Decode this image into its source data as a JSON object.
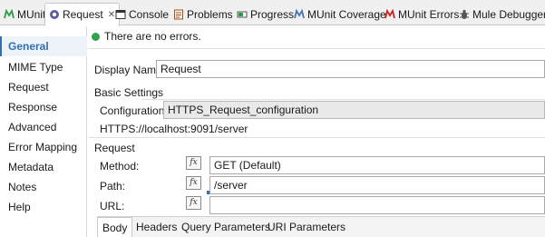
{
  "tabs": [
    {
      "label": "MUnit",
      "icon": "munit-icon",
      "color": "#2e9a47"
    },
    {
      "label": "Request",
      "icon": "request-icon",
      "color": "#5a5aa8",
      "active": true
    },
    {
      "label": "Console",
      "icon": "console-icon",
      "color": "#333333"
    },
    {
      "label": "Problems",
      "icon": "problems-icon",
      "color": "#a0522d"
    },
    {
      "label": "Progress",
      "icon": "progress-icon",
      "color": "#2e9a47"
    },
    {
      "label": "MUnit Coverage",
      "icon": "munit-coverage-icon",
      "color": "#4a74b8"
    },
    {
      "label": "MUnit Errors",
      "icon": "munit-errors-icon",
      "color": "#d02020"
    },
    {
      "label": "Mule Debugger",
      "icon": "mule-debugger-icon",
      "color": "#555555"
    }
  ],
  "close_glyph": "✕",
  "nav": {
    "items": [
      "General",
      "MIME Type",
      "Request",
      "Response",
      "Advanced",
      "Error Mapping",
      "Metadata",
      "Notes",
      "Help"
    ],
    "active": "General"
  },
  "status": {
    "message": "There are no errors."
  },
  "display_name": {
    "label": "Display Name:",
    "value": "Request"
  },
  "basic_settings": {
    "title": "Basic Settings",
    "configuration_label": "Configuration:",
    "configuration_value": "HTTPS_Request_configuration",
    "url": "HTTPS://localhost:9091/server"
  },
  "request": {
    "title": "Request",
    "method_label": "Method:",
    "method_value": "GET (Default)",
    "path_label": "Path:",
    "path_value": "/server",
    "url_label": "URL:",
    "url_value": "",
    "fx_symbol": "fx"
  },
  "body_tabs": [
    "Body",
    "Headers",
    "Query Parameters",
    "URI Parameters"
  ],
  "colors": {
    "accent": "#2f6fb4",
    "ok": "#2ea44f"
  }
}
